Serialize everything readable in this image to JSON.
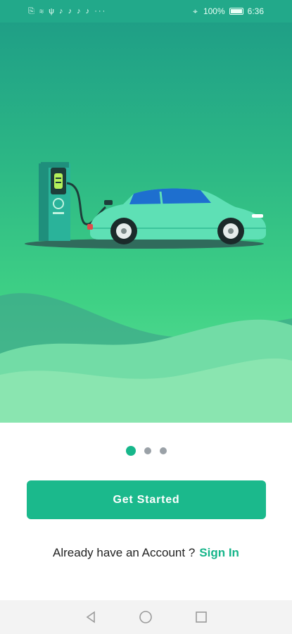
{
  "status_bar": {
    "left_icons": "⎘ ≋ ψ ♪ ♪ ♪ ♪ ···",
    "battery_percent": "100%",
    "time": "6:36"
  },
  "onboarding": {
    "page_count": 3,
    "active_page": 1,
    "primary_button_label": "Get Started",
    "account_prompt": "Already have an Account ?",
    "sign_in_label": "Sign In"
  },
  "colors": {
    "brand": "#1bb98c",
    "car_body": "#5ee0b5",
    "car_glass": "#1e6fcf",
    "charger": "#2ab39a"
  },
  "icons": {
    "nav_back": "back-triangle-icon",
    "nav_home": "home-circle-icon",
    "nav_recents": "recents-square-icon"
  }
}
